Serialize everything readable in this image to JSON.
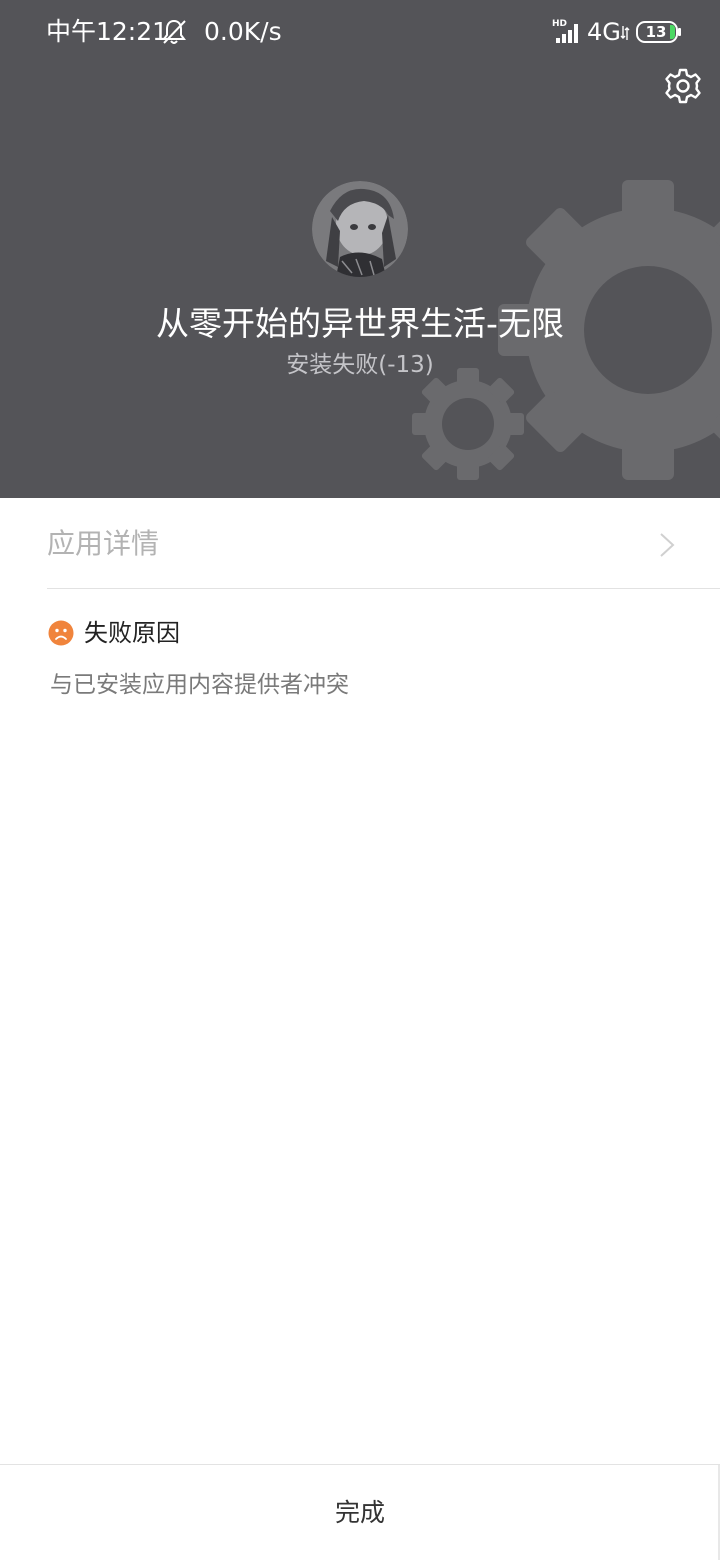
{
  "status_bar": {
    "time": "中午12:21",
    "net_speed": "0.0K/s",
    "network_type": "4G",
    "battery": "13",
    "icons": [
      "mute-bell-icon",
      "hd-signal-icon",
      "battery-icon"
    ]
  },
  "header": {
    "settings_icon": "gear-icon",
    "app_name": "从零开始的异世界生活-无限",
    "status": "安装失败(-13)"
  },
  "details": {
    "label": "应用详情",
    "chevron_icon": "chevron-right-icon"
  },
  "failure": {
    "icon": "sad-face-icon",
    "title": "失败原因",
    "message": "与已安装应用内容提供者冲突"
  },
  "footer": {
    "done_label": "完成"
  },
  "colors": {
    "header_bg": "#545458",
    "accent_orange": "#f0843c",
    "battery_green": "#4cd964"
  }
}
